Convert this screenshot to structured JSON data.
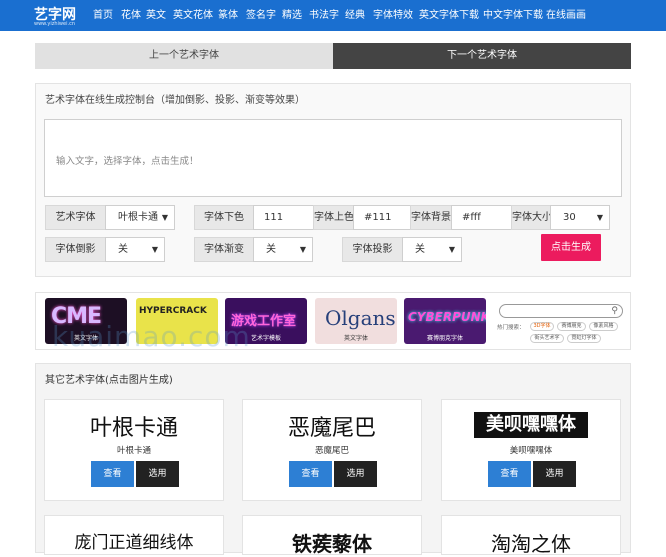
{
  "brand": {
    "name": "艺字网",
    "domain": "www.yizhiwei.cn",
    "color": "#1a6fd0"
  },
  "nav": [
    "首页",
    "花体",
    "英文",
    "英文花体",
    "篆体",
    "签名字",
    "精选",
    "书法字",
    "经典",
    "字体特效",
    "英文字体下载",
    "中文字体下载",
    "在线画画"
  ],
  "pager": {
    "prev": "上一个艺术字体",
    "next": "下一个艺术字体"
  },
  "panel": {
    "title": "艺术字体在线生成控制台（增加倒影、投影、渐变等效果）",
    "placeholder": "输入文字，选择字体，点击生成！",
    "font_label": "艺术字体",
    "font_value": "叶根卡通",
    "bottom_color_label": "字体下色",
    "bottom_color_value": "111",
    "top_color_label": "字体上色",
    "top_color_value": "#111",
    "bg_label": "字体背景",
    "bg_value": "#fff",
    "size_label": "字体大小",
    "size_value": "30",
    "reflect_label": "字体倒影",
    "reflect_value": "关",
    "gradient_label": "字体渐变",
    "gradient_value": "关",
    "shadow_label": "字体投影",
    "shadow_value": "关",
    "generate": "点击生成",
    "accent": "#ec1b5e"
  },
  "banner": {
    "thumbs": [
      {
        "text": "CME",
        "caption": "英文字体"
      },
      {
        "text": "HYPERCRACK",
        "caption": ""
      },
      {
        "text": "游戏工作室",
        "caption": "艺术字模板"
      },
      {
        "text": "Olgans",
        "caption": "英文字体"
      },
      {
        "text": "CYBERPUNK",
        "caption": "赛博朋克字体"
      }
    ],
    "hot_label": "热门搜索：",
    "tags": [
      "3D字体",
      "赛博朋克",
      "像素风格",
      "街头艺术字",
      "霓虹灯字体"
    ],
    "watermark": "kuaimao.com"
  },
  "others": {
    "title": "其它艺术字体(点击图片生成)",
    "view": "查看",
    "use": "选用",
    "cards": [
      {
        "sample": "叶根卡通",
        "name": "叶根卡通"
      },
      {
        "sample": "恶魔尾巴",
        "name": "恶魔尾巴"
      },
      {
        "sample": "美呗嘿嘿体",
        "name": "美呗嘿嘿体"
      }
    ],
    "row2": [
      "庞门正道细线体",
      "铁蒺藜体",
      "淘淘之体"
    ]
  }
}
